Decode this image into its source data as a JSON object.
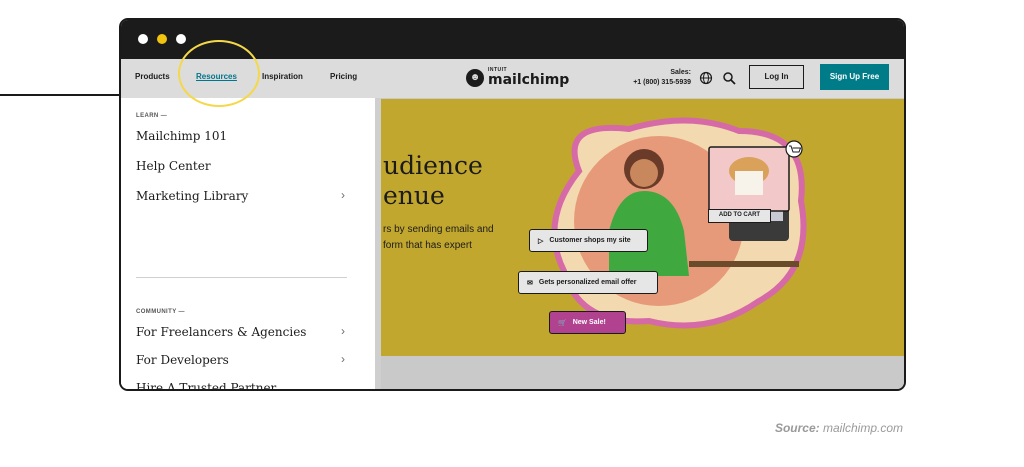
{
  "window": {
    "dots": [
      "#ffffff",
      "#f1c40f",
      "#ffffff"
    ]
  },
  "nav": {
    "items": [
      "Products",
      "Resources",
      "Inspiration",
      "Pricing"
    ],
    "logo_small": "INTUIT",
    "logo_big": "mailchimp",
    "sales_label": "Sales:",
    "sales_phone": "+1 (800) 315-5939",
    "login_label": "Log In",
    "signup_label": "Sign Up Free",
    "globe_icon": "globe-icon",
    "search_icon": "search-icon"
  },
  "hero": {
    "title_line1": "udience",
    "title_line2": "enue",
    "body_line1": "rs by sending emails and",
    "body_line2": "form that has expert",
    "background_color": "#c2a72e",
    "chips": {
      "shops": "Customer shops my site",
      "email": "Gets personalized email offer",
      "sale": "New Sale!",
      "cart": "ADD TO CART"
    }
  },
  "menu": {
    "learn_heading": "LEARN —",
    "learn_items": [
      {
        "label": "Mailchimp 101",
        "has_submenu": false
      },
      {
        "label": "Help Center",
        "has_submenu": false
      },
      {
        "label": "Marketing Library",
        "has_submenu": true
      }
    ],
    "community_heading": "COMMUNITY —",
    "community_items": [
      {
        "label": "For Freelancers & Agencies",
        "has_submenu": true
      },
      {
        "label": "For Developers",
        "has_submenu": true
      },
      {
        "label": "Hire A Trusted Partner",
        "has_submenu": false
      }
    ]
  },
  "footer": {
    "source_prefix": "Source:",
    "source_value": "mailchimp.com"
  },
  "colors": {
    "accent": "#007c89",
    "highlight": "#f5d84a",
    "chrome": "#1b1b1b"
  }
}
